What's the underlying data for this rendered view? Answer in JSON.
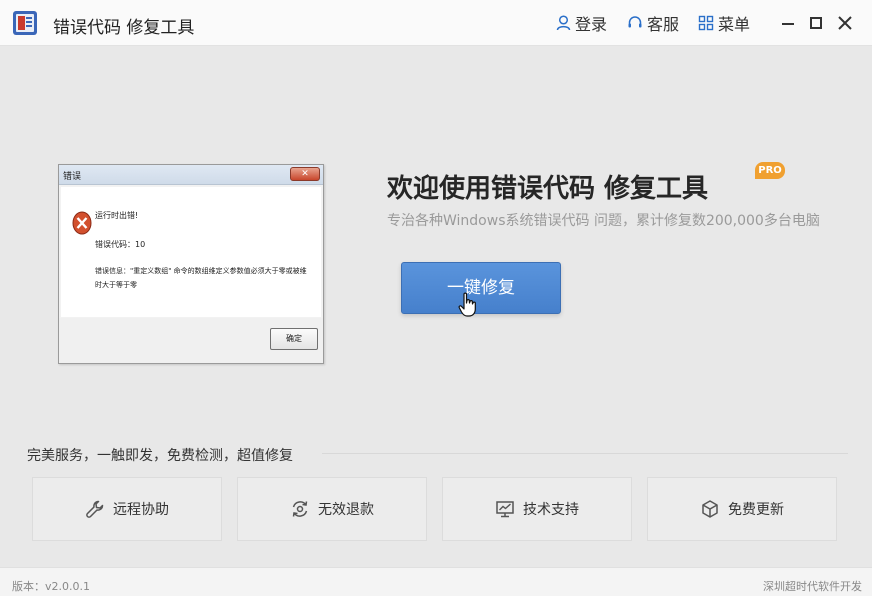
{
  "app": {
    "title": "错误代码 修复工具"
  },
  "titlebar": {
    "login_label": "登录",
    "service_label": "客服",
    "menu_label": "菜单"
  },
  "dialog": {
    "title": "错误",
    "close_label": "✕",
    "line1": "运行时出错!",
    "line2": "错误代码：10",
    "line3": "错误信息：\"重定义数组\" 命令的数组维定义参数值必须大于零或被维",
    "line4": "时大于等于零",
    "ok_label": "确定"
  },
  "welcome": {
    "heading": "欢迎使用错误代码 修复工具",
    "badge": "PRO",
    "subtitle": "专治各种Windows系统错误代码 问题，累计修复数200,000多台电脑",
    "repair_button": "一键修复"
  },
  "services": {
    "label": "完美服务，一触即发，免费检测，超值修复",
    "cards": [
      {
        "label": "远程协助",
        "icon": "wrench-icon"
      },
      {
        "label": "无效退款",
        "icon": "refund-icon"
      },
      {
        "label": "技术支持",
        "icon": "monitor-chart-icon"
      },
      {
        "label": "免费更新",
        "icon": "cube-icon"
      }
    ]
  },
  "footer": {
    "version": "版本：v2.0.0.1",
    "company": "深圳超时代软件开发"
  },
  "colors": {
    "accent": "#4a86d0",
    "badge": "#f0a030",
    "icon_blue": "#2a6fc9"
  }
}
